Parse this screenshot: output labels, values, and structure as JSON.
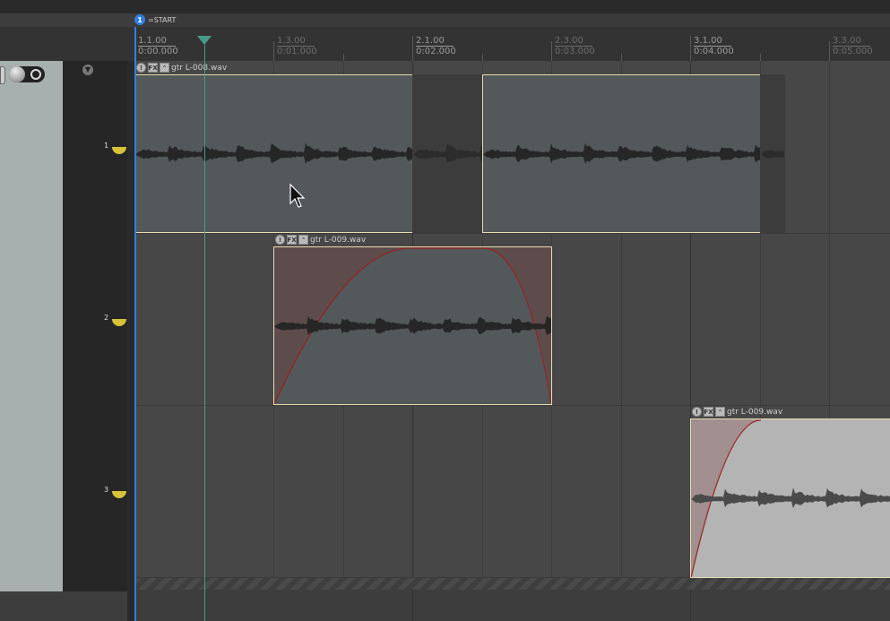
{
  "marker": {
    "number": "1",
    "label": "=START",
    "color": "#2f7fe0"
  },
  "ruler": [
    {
      "bar": "1.1.00",
      "time": "0:00.000",
      "major": true
    },
    {
      "bar": "1.3.00",
      "time": "0:01.000",
      "major": false
    },
    {
      "bar": "2.1.00",
      "time": "0:02.000",
      "major": true
    },
    {
      "bar": "2.3.00",
      "time": "0:03.000",
      "major": false
    },
    {
      "bar": "3.1.00",
      "time": "0:04.000",
      "major": true
    },
    {
      "bar": "3.3.00",
      "time": "0:05.000",
      "major": false
    }
  ],
  "tracks": [
    {
      "number": "1"
    },
    {
      "number": "2"
    },
    {
      "number": "3"
    }
  ],
  "items": [
    {
      "name": "gtr L-008.wav",
      "fx": "FX"
    },
    {
      "name": "gtr L-009.wav",
      "fx": "FX"
    },
    {
      "name": "gtr L-009.wav",
      "fx": "FX"
    }
  ],
  "colors": {
    "edit_cursor": "#4a9a88",
    "item_border": "#e6ddb0",
    "fade": "#9a2020",
    "record_arm": "#d8c23a"
  }
}
